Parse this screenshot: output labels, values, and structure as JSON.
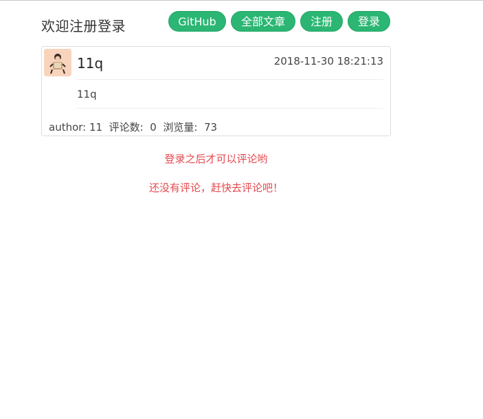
{
  "header": {
    "site_title": "欢迎注册登录",
    "nav": [
      {
        "label": "GitHub"
      },
      {
        "label": "全部文章"
      },
      {
        "label": "注册"
      },
      {
        "label": "登录"
      }
    ]
  },
  "post": {
    "title": "11q",
    "timestamp": "2018-11-30 18:21:13",
    "body": "11q",
    "meta": {
      "author_label": "author:",
      "author_value": "11",
      "comments_label": "评论数:",
      "comments_value": "0",
      "views_label": "浏览量:",
      "views_value": "73"
    }
  },
  "comments": {
    "login_notice": "登录之后才可以评论哟",
    "empty_notice": "还没有评论，赶快去评论吧！"
  },
  "colors": {
    "accent": "#2bb673",
    "notice": "#e5484d"
  }
}
